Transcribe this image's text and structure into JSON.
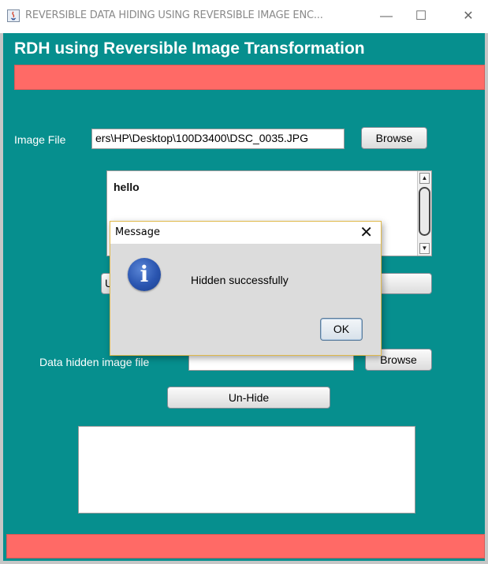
{
  "window": {
    "title": "REVERSIBLE DATA HIDING USING REVERSIBLE IMAGE ENC...",
    "minimize": "—",
    "maximize": "☐",
    "close": "✕"
  },
  "app": {
    "heading": "RDH using Reversible Image Transformation",
    "image_file_label": "Image File",
    "image_file_value": "ers\\HP\\Desktop\\100D3400\\DSC_0035.JPG",
    "browse_label": "Browse",
    "message_text": "hello",
    "hide_button_partial": "U",
    "data_hidden_label": "Data hidden image file",
    "data_hidden_value": "",
    "browse2_label": "Browse",
    "unhide_label": "Un-Hide",
    "output_text": ""
  },
  "dialog": {
    "title": "Message",
    "close": "✕",
    "icon": "information-icon",
    "message": "Hidden successfully",
    "ok_label": "OK"
  },
  "colors": {
    "background": "#068f8e",
    "status_bar": "#ff6a66",
    "dialog_border": "#e0b94a"
  }
}
